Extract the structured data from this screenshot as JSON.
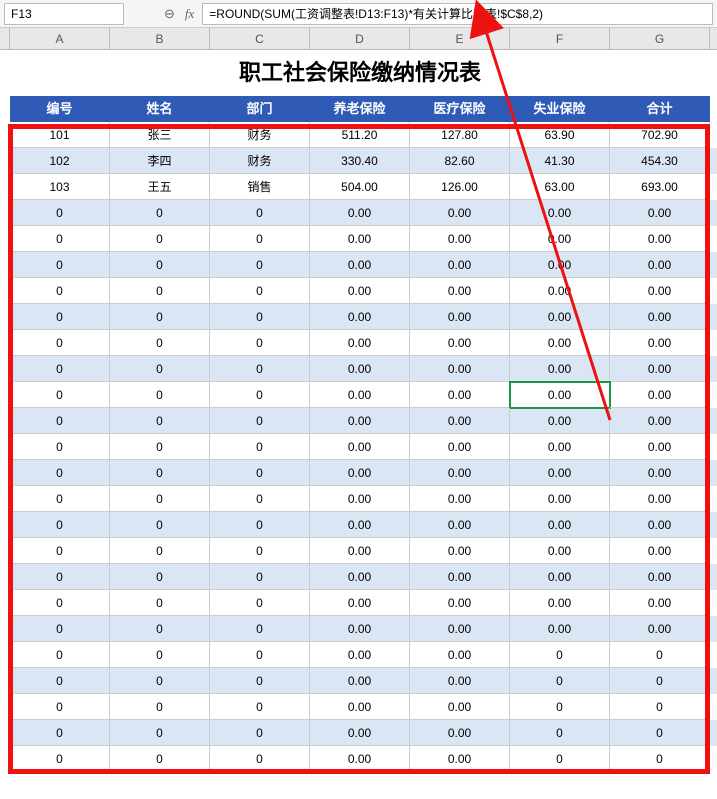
{
  "formula_bar": {
    "cell_ref": "F13",
    "formula": "=ROUND(SUM(工资调整表!D13:F13)*有关计算比率表!$C$8,2)"
  },
  "col_headers": [
    "A",
    "B",
    "C",
    "D",
    "E",
    "F",
    "G"
  ],
  "title": "职工社会保险缴纳情况表",
  "table_headers": [
    "编号",
    "姓名",
    "部门",
    "养老保险",
    "医疗保险",
    "失业保险",
    "合计"
  ],
  "rows": [
    {
      "id": "101",
      "name": "张三",
      "dept": "财务",
      "v1": "511.20",
      "v2": "127.80",
      "v3": "63.90",
      "sum": "702.90"
    },
    {
      "id": "102",
      "name": "李四",
      "dept": "财务",
      "v1": "330.40",
      "v2": "82.60",
      "v3": "41.30",
      "sum": "454.30"
    },
    {
      "id": "103",
      "name": "王五",
      "dept": "销售",
      "v1": "504.00",
      "v2": "126.00",
      "v3": "63.00",
      "sum": "693.00"
    },
    {
      "id": "0",
      "name": "0",
      "dept": "0",
      "v1": "0.00",
      "v2": "0.00",
      "v3": "0.00",
      "sum": "0.00"
    },
    {
      "id": "0",
      "name": "0",
      "dept": "0",
      "v1": "0.00",
      "v2": "0.00",
      "v3": "0.00",
      "sum": "0.00"
    },
    {
      "id": "0",
      "name": "0",
      "dept": "0",
      "v1": "0.00",
      "v2": "0.00",
      "v3": "0.00",
      "sum": "0.00"
    },
    {
      "id": "0",
      "name": "0",
      "dept": "0",
      "v1": "0.00",
      "v2": "0.00",
      "v3": "0.00",
      "sum": "0.00"
    },
    {
      "id": "0",
      "name": "0",
      "dept": "0",
      "v1": "0.00",
      "v2": "0.00",
      "v3": "0.00",
      "sum": "0.00"
    },
    {
      "id": "0",
      "name": "0",
      "dept": "0",
      "v1": "0.00",
      "v2": "0.00",
      "v3": "0.00",
      "sum": "0.00"
    },
    {
      "id": "0",
      "name": "0",
      "dept": "0",
      "v1": "0.00",
      "v2": "0.00",
      "v3": "0.00",
      "sum": "0.00"
    },
    {
      "id": "0",
      "name": "0",
      "dept": "0",
      "v1": "0.00",
      "v2": "0.00",
      "v3": "0.00",
      "sum": "0.00"
    },
    {
      "id": "0",
      "name": "0",
      "dept": "0",
      "v1": "0.00",
      "v2": "0.00",
      "v3": "0.00",
      "sum": "0.00"
    },
    {
      "id": "0",
      "name": "0",
      "dept": "0",
      "v1": "0.00",
      "v2": "0.00",
      "v3": "0.00",
      "sum": "0.00"
    },
    {
      "id": "0",
      "name": "0",
      "dept": "0",
      "v1": "0.00",
      "v2": "0.00",
      "v3": "0.00",
      "sum": "0.00"
    },
    {
      "id": "0",
      "name": "0",
      "dept": "0",
      "v1": "0.00",
      "v2": "0.00",
      "v3": "0.00",
      "sum": "0.00"
    },
    {
      "id": "0",
      "name": "0",
      "dept": "0",
      "v1": "0.00",
      "v2": "0.00",
      "v3": "0.00",
      "sum": "0.00"
    },
    {
      "id": "0",
      "name": "0",
      "dept": "0",
      "v1": "0.00",
      "v2": "0.00",
      "v3": "0.00",
      "sum": "0.00"
    },
    {
      "id": "0",
      "name": "0",
      "dept": "0",
      "v1": "0.00",
      "v2": "0.00",
      "v3": "0.00",
      "sum": "0.00"
    },
    {
      "id": "0",
      "name": "0",
      "dept": "0",
      "v1": "0.00",
      "v2": "0.00",
      "v3": "0.00",
      "sum": "0.00"
    },
    {
      "id": "0",
      "name": "0",
      "dept": "0",
      "v1": "0.00",
      "v2": "0.00",
      "v3": "0.00",
      "sum": "0.00"
    },
    {
      "id": "0",
      "name": "0",
      "dept": "0",
      "v1": "0.00",
      "v2": "0.00",
      "v3": "0",
      "sum": "0"
    },
    {
      "id": "0",
      "name": "0",
      "dept": "0",
      "v1": "0.00",
      "v2": "0.00",
      "v3": "0",
      "sum": "0"
    },
    {
      "id": "0",
      "name": "0",
      "dept": "0",
      "v1": "0.00",
      "v2": "0.00",
      "v3": "0",
      "sum": "0"
    },
    {
      "id": "0",
      "name": "0",
      "dept": "0",
      "v1": "0.00",
      "v2": "0.00",
      "v3": "0",
      "sum": "0"
    },
    {
      "id": "0",
      "name": "0",
      "dept": "0",
      "v1": "0.00",
      "v2": "0.00",
      "v3": "0",
      "sum": "0"
    }
  ],
  "selected_cell": {
    "row_index": 10,
    "col": "v3"
  }
}
